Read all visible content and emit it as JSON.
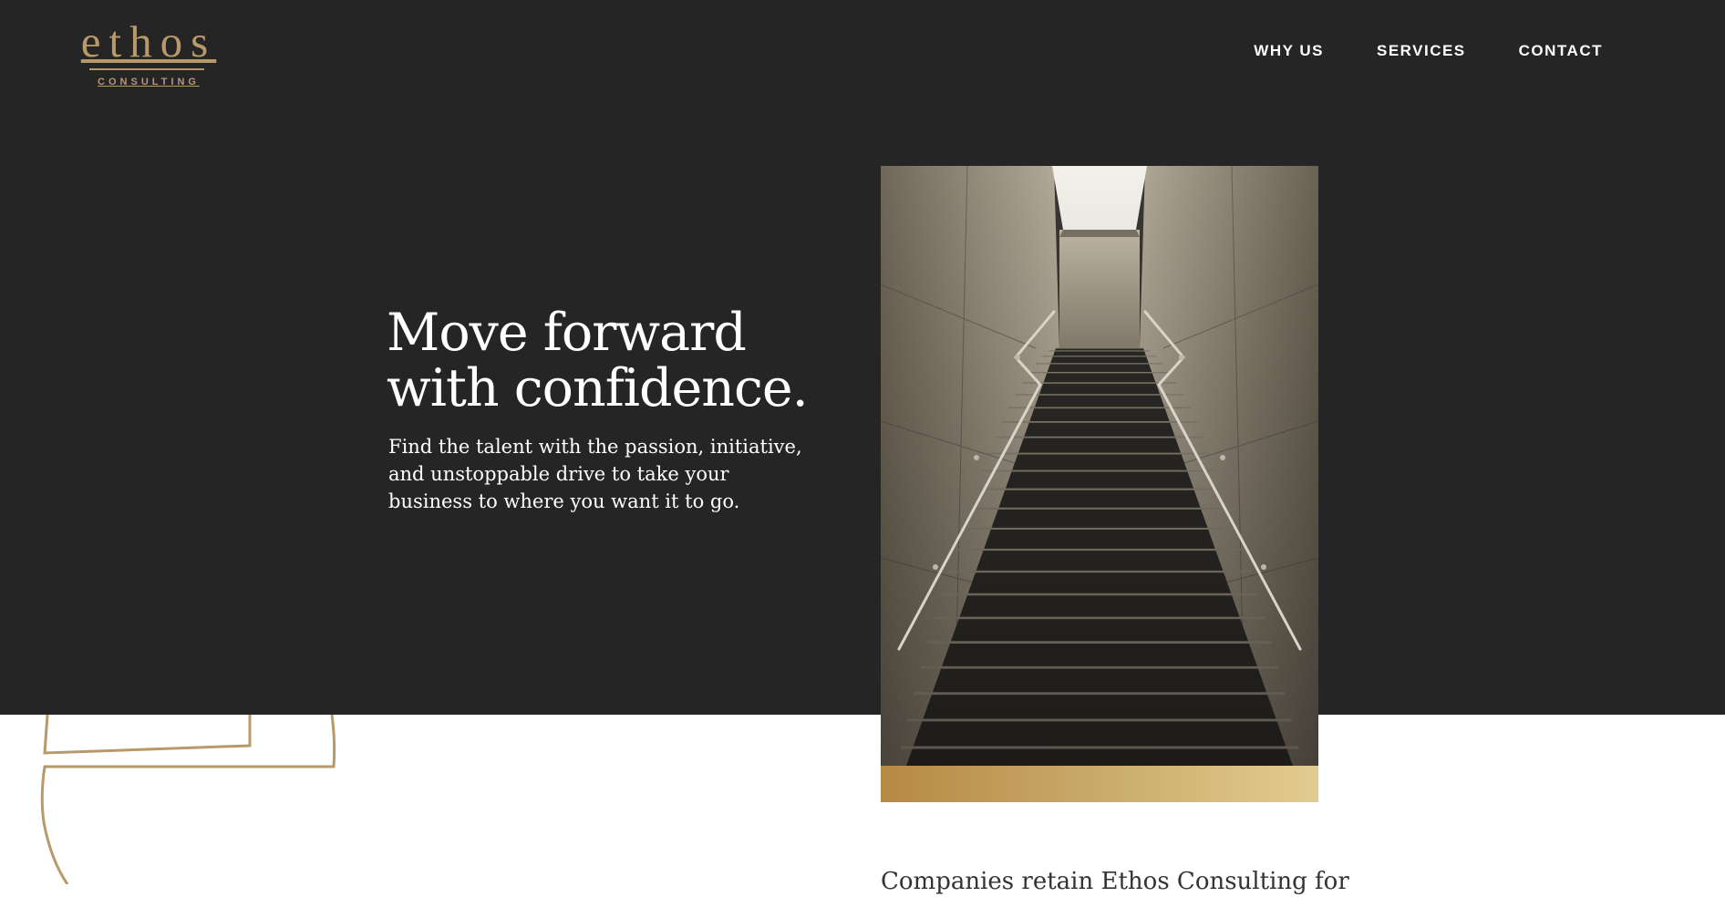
{
  "brand": {
    "logo_word": "ethos",
    "logo_sub": "CONSULTING"
  },
  "nav": {
    "items": [
      {
        "label": "WHY US"
      },
      {
        "label": "SERVICES"
      },
      {
        "label": "CONTACT"
      }
    ]
  },
  "hero": {
    "title_line1": "Move forward",
    "title_line2": "with confidence.",
    "subtitle": "Find the talent with the passion, initiative, and unstoppable drive to take your business to where you want it to go."
  },
  "intro": {
    "text": "Companies retain Ethos Consulting for"
  },
  "colors": {
    "hero_bg": "#252525",
    "gold": "#b8996a",
    "page_bg": "#ffffff"
  }
}
